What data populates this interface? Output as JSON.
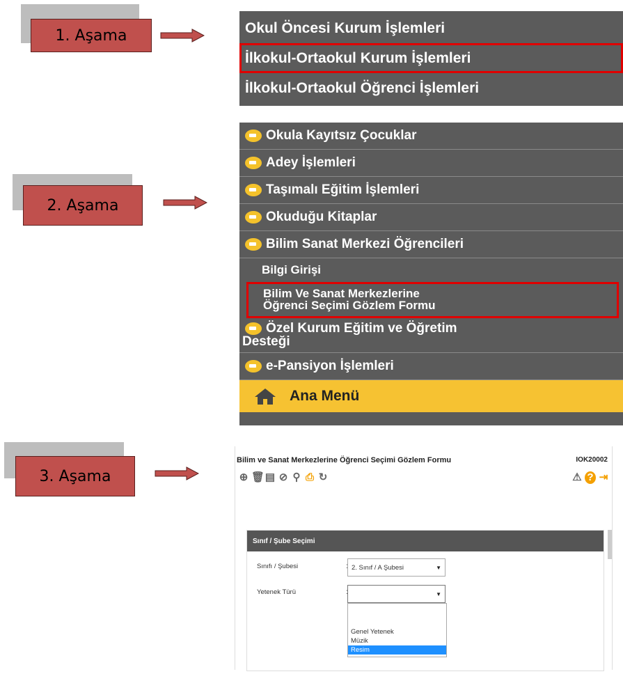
{
  "steps": [
    {
      "label": "1. Aşama"
    },
    {
      "label": "2. Aşama"
    },
    {
      "label": "3. Aşama"
    }
  ],
  "menu1": {
    "items": [
      {
        "label": "Okul Öncesi Kurum İşlemleri",
        "highlighted": false
      },
      {
        "label": "İlkokul-Ortaokul Kurum İşlemleri",
        "highlighted": true
      },
      {
        "label": "İlkokul-Ortaokul Öğrenci İşlemleri",
        "highlighted": false
      }
    ]
  },
  "menu2": {
    "items": [
      {
        "label": "Okula Kayıtsız Çocuklar",
        "icon": "arrow-circle-icon"
      },
      {
        "label": "Adey İşlemleri",
        "icon": "arrow-circle-icon"
      },
      {
        "label": "Taşımalı Eğitim İşlemleri",
        "icon": "arrow-circle-icon"
      },
      {
        "label": "Okuduğu Kitaplar",
        "icon": "arrow-circle-icon"
      },
      {
        "label": "Bilim Sanat Merkezi Öğrencileri",
        "icon": "arrow-circle-icon"
      }
    ],
    "sub_items": [
      {
        "label": "Bilgi Girişi"
      },
      {
        "label_line1": "Bilim Ve Sanat Merkezlerine",
        "label_line2": "Öğrenci Seçimi Gözlem Formu",
        "highlighted": true
      }
    ],
    "after": [
      {
        "label_line1": "Özel Kurum Eğitim ve Öğretim",
        "label_line2": "Desteği",
        "icon": "arrow-circle-icon"
      },
      {
        "label": "e-Pansiyon İşlemleri",
        "icon": "arrow-circle-icon"
      }
    ],
    "home": {
      "label": "Ana Menü",
      "icon": "home-icon"
    }
  },
  "form": {
    "title": "Bilim ve Sanat Merkezlerine Öğrenci Seçimi Gözlem Formu",
    "code": "IOK20002",
    "section_title": "Sınıf / Şube Seçimi",
    "fields": [
      {
        "label": "Sınıfı / Şubesi",
        "value": "2. Sınıf / A Şubesi"
      },
      {
        "label": "Yetenek Türü",
        "value": ""
      }
    ],
    "dropdown_options": [
      "Genel Yetenek",
      "Müzik",
      "Resim"
    ],
    "dropdown_selected": "Resim"
  },
  "colors": {
    "step_fill": "#c0504d",
    "menu_bg": "#5b5b5b",
    "highlight": "#e00000",
    "home_bar": "#f6c232",
    "selected_option": "#1e90ff"
  }
}
